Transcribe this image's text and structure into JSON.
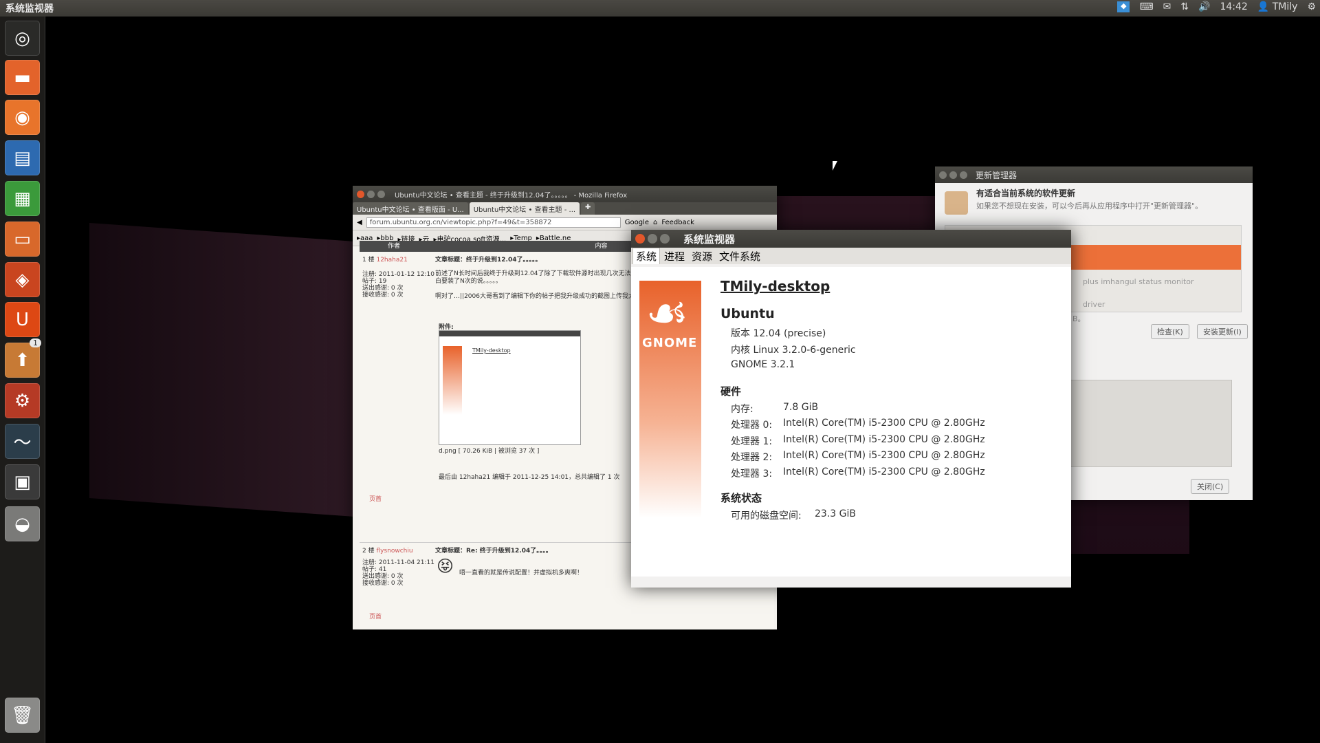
{
  "topbar": {
    "app_title": "系统监视器",
    "time": "14:42",
    "user": "TMily",
    "tray_icons": [
      "dropbox-icon",
      "keyboard-icon",
      "mail-icon",
      "network-icon",
      "volume-icon"
    ]
  },
  "launcher": {
    "items": [
      {
        "name": "dash-icon",
        "color": "#2a2a28",
        "glyph": "◎"
      },
      {
        "name": "files-icon",
        "color": "#e3632b",
        "glyph": "▬"
      },
      {
        "name": "firefox-icon",
        "color": "#e8742b",
        "glyph": "◉"
      },
      {
        "name": "writer-icon",
        "color": "#2d6ab0",
        "glyph": "▤"
      },
      {
        "name": "calc-icon",
        "color": "#3b9a3b",
        "glyph": "▦"
      },
      {
        "name": "impress-icon",
        "color": "#d8682b",
        "glyph": "▭"
      },
      {
        "name": "software-center-icon",
        "color": "#c9451f",
        "glyph": "◈"
      },
      {
        "name": "ubuntu-one-icon",
        "color": "#dd4814",
        "glyph": "U"
      },
      {
        "name": "update-manager-icon",
        "color": "#c77a35",
        "glyph": "⬆",
        "badge": "1"
      },
      {
        "name": "system-settings-icon",
        "color": "#b53a25",
        "glyph": "⚙"
      },
      {
        "name": "system-monitor-icon",
        "color": "#2b3d4a",
        "glyph": "〜"
      },
      {
        "name": "workspace-switcher-icon",
        "color": "#3a3a3a",
        "glyph": "▣"
      },
      {
        "name": "disk-icon",
        "color": "#7a7a78",
        "glyph": "◒"
      },
      {
        "name": "trash-icon",
        "color": "#8a8a88",
        "glyph": "🗑"
      }
    ]
  },
  "firefox": {
    "title": "Ubuntu中文论坛 • 查看主题 - 终于升级到12.04了。。。。。 - Mozilla Firefox",
    "tabs": [
      "Ubuntu中文论坛 • 查看版面 - U...",
      "Ubuntu中文论坛 • 查看主题 - ..."
    ],
    "url": "forum.ubuntu.org.cn/viewtopic.php?f=49&t=358872",
    "search": "Google",
    "feedback": "Feedback",
    "bookmarks": [
      "aaa",
      "bbb",
      "链接",
      "云",
      "电驴cocoa soft资源...",
      "Temp",
      "Battle.ne"
    ],
    "col_author": "作者",
    "col_content": "内容",
    "post1": {
      "floor": "1 楼",
      "user": "12haha21",
      "meta": [
        "注册: 2011-01-12 12:10",
        "帖子: 19",
        "送出感谢: 0 次",
        "接收感谢: 0 次"
      ],
      "subject": "文章标题：终于升级到12.04了。。。。。",
      "body1": "前述了N长时间后我终于升级到12.04了除了下载软件源时出现几次无法下载到错误，很快就解决了，",
      "body1b": "白要装了N次的说。。。。。",
      "body2": "啊对了…||2006大哥看到了编辑下你的帖子把我升级成功的截图上传我大概3周前...",
      "attach_label": "附件:",
      "attach_file": "d.png [ 70.26 KiB | 被浏览 37 次 ]",
      "edited": "最后由 12haha21 编辑于 2011-12-25 14:01，总共编辑了 1 次",
      "top": "页首"
    },
    "post2": {
      "floor": "2 楼",
      "user": "flysnowchiu",
      "meta": [
        "注册: 2011-11-04 21:11",
        "帖子: 41",
        "送出感谢: 0 次",
        "接收感谢: 0 次"
      ],
      "subject": "文章标题：Re: 终于升级到12.04了。。。。",
      "body": "唔一直看的就是传说配置！并虚拟机多爽啊！",
      "top": "页首"
    }
  },
  "update_manager": {
    "title": "更新管理器",
    "heading": "有适合当前系统的软件更新",
    "subheading": "如果您不想现在安装，可以今后再从应用程序中打开\"更新管理器\"。",
    "item_partial1": "plus imhangul status monitor",
    "item_partial2": "driver",
    "item_partial3": "B。",
    "check_button": "检查(K)",
    "install_button": "安装更新(I)",
    "close_button": "关闭(C)"
  },
  "system_monitor": {
    "title": "系统监视器",
    "tabs": [
      "系统",
      "进程",
      "资源",
      "文件系统"
    ],
    "logo_text": "GNOME",
    "hostname": "TMily-desktop",
    "os_heading": "Ubuntu",
    "version": "版本 12.04 (precise)",
    "kernel": "内核 Linux 3.2.0-6-generic",
    "gnome": "GNOME 3.2.1",
    "hardware_heading": "硬件",
    "memory_label": "内存:",
    "memory_value": "7.8 GiB",
    "cpus": [
      {
        "label": "处理器 0:",
        "value": "Intel(R) Core(TM) i5-2300 CPU @ 2.80GHz"
      },
      {
        "label": "处理器 1:",
        "value": "Intel(R) Core(TM) i5-2300 CPU @ 2.80GHz"
      },
      {
        "label": "处理器 2:",
        "value": "Intel(R) Core(TM) i5-2300 CPU @ 2.80GHz"
      },
      {
        "label": "处理器 3:",
        "value": "Intel(R) Core(TM) i5-2300 CPU @ 2.80GHz"
      }
    ],
    "status_heading": "系统状态",
    "disk_label": "可用的磁盘空间:",
    "disk_value": "23.3 GiB"
  }
}
